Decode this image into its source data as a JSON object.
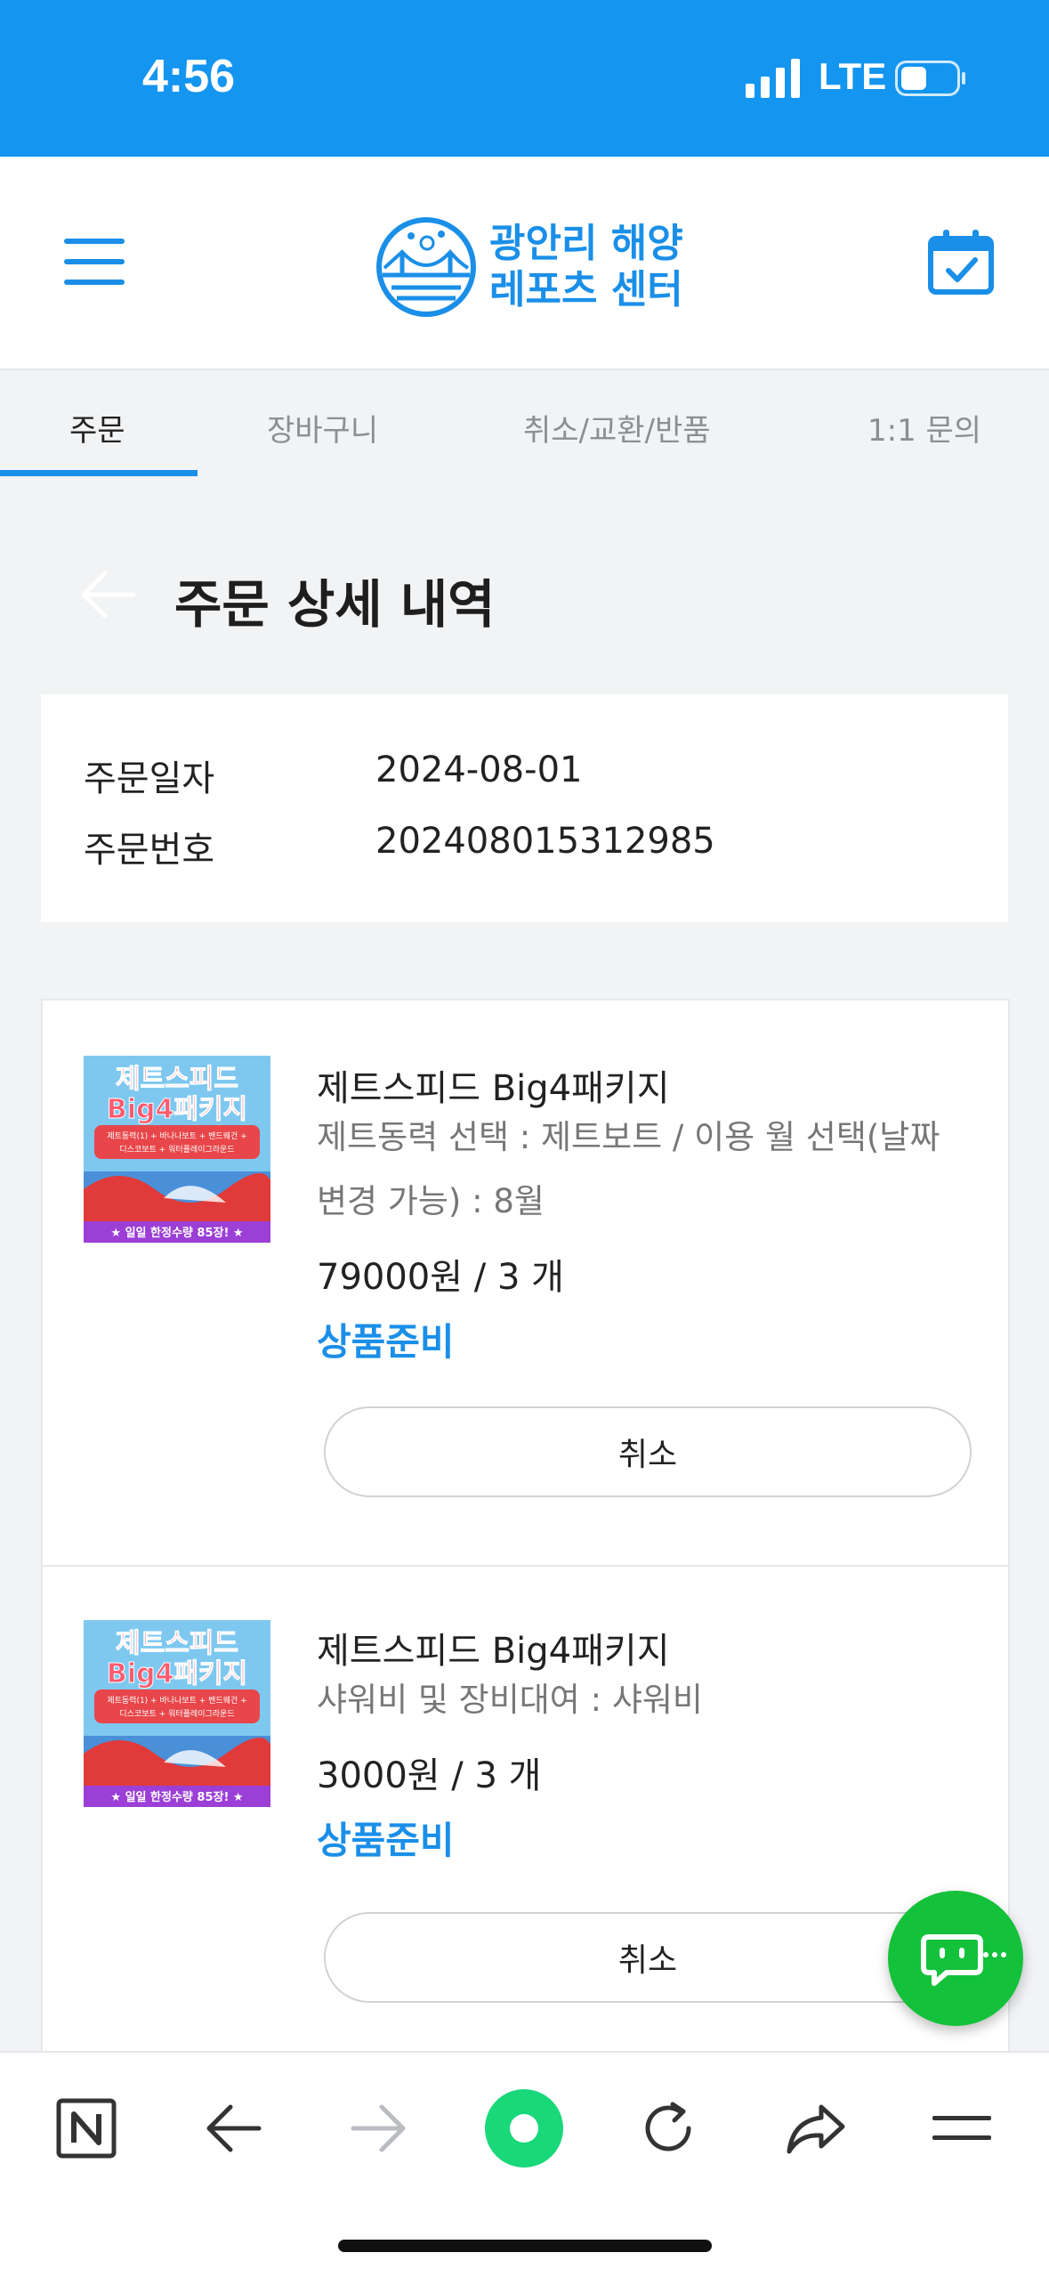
{
  "status_bar": {
    "time": "4:56",
    "network": "LTE"
  },
  "header": {
    "logo_line1": "광안리 해양",
    "logo_line2": "레포츠 센터"
  },
  "tabs": [
    {
      "label": "주문",
      "active": true
    },
    {
      "label": "장바구니",
      "active": false
    },
    {
      "label": "취소/교환/반품",
      "active": false
    },
    {
      "label": "1:1 문의",
      "active": false
    }
  ],
  "page_title": "주문 상세 내역",
  "order": {
    "date_label": "주문일자",
    "date_value": "2024-08-01",
    "number_label": "주문번호",
    "number_value": "202408015312985"
  },
  "items": [
    {
      "name": "제트스피드 Big4패키지",
      "option": "제트동력 선택 : 제트보트 / 이용 월 선택(날짜 변경 가능) : 8월",
      "price": "79000원 / 3 개",
      "status": "상품준비",
      "cancel_label": "취소",
      "thumb": {
        "title1": "제트스피드",
        "title2": "Big4패키지",
        "desc1": "제트동력(1) + 바나나보트 + 밴드웨건 +",
        "desc2": "디스코보트 + 워터플레이그라운드",
        "badge": "★ 일일 한정수량 85장! ★"
      }
    },
    {
      "name": "제트스피드 Big4패키지",
      "option": "샤워비 및 장비대여 : 샤워비",
      "price": "3000원 / 3 개",
      "status": "상품준비",
      "cancel_label": "취소",
      "thumb": {
        "title1": "제트스피드",
        "title2": "Big4패키지",
        "desc1": "제트동력(1) + 바나나보트 + 밴드웨건 +",
        "desc2": "디스코보트 + 워터플레이그라운드",
        "badge": "★ 일일 한정수량 85장! ★"
      }
    }
  ],
  "icons": {
    "menu": "hamburger-icon",
    "calendar": "calendar-check-icon",
    "back": "arrow-left-icon",
    "chat": "chat-bubble-icon",
    "toolbar": [
      "naver-n-icon",
      "arrow-left-icon",
      "arrow-right-icon",
      "green-dot-icon",
      "refresh-icon",
      "share-icon",
      "menu-lines-icon"
    ]
  },
  "colors": {
    "accent": "#1a8fe8",
    "status_bar": "#1495f0",
    "chat": "#13c13a",
    "status_text": "#1a8fe8"
  }
}
